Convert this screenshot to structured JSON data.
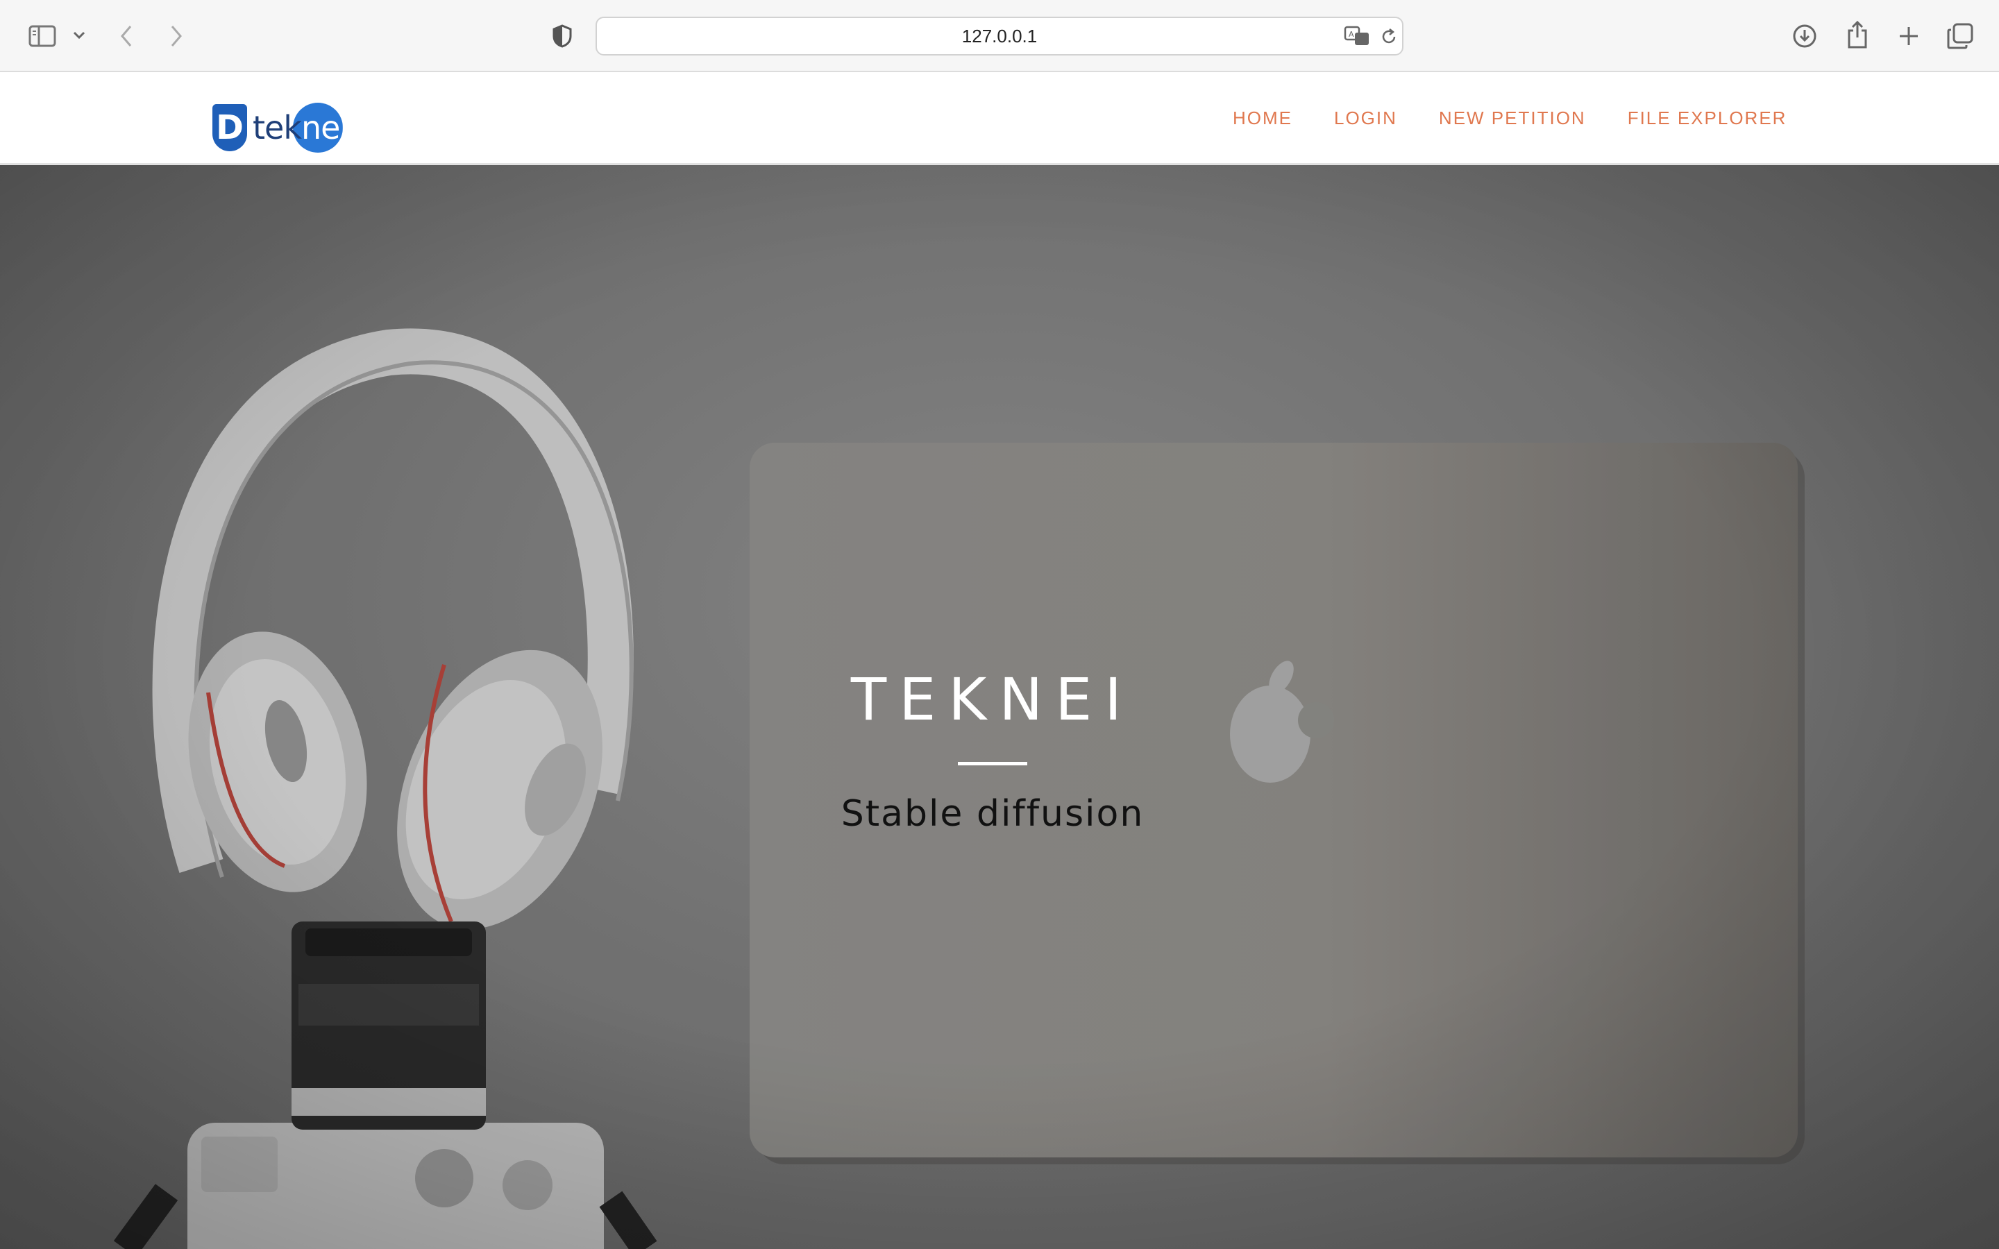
{
  "browser": {
    "url": "127.0.0.1",
    "icons": [
      "sidebar-icon",
      "chevron-down-icon",
      "back-icon",
      "forward-icon",
      "shield-icon",
      "translate-icon",
      "reload-icon",
      "download-icon",
      "share-icon",
      "new-tab-icon",
      "tabs-overview-icon"
    ]
  },
  "site": {
    "logo": {
      "letter": "D",
      "text_part1": "tek",
      "text_part2": "nei"
    },
    "nav": [
      "HOME",
      "LOGIN",
      "NEW PETITION",
      "FILE EXPLORER"
    ],
    "accent_color": "#e0784f"
  },
  "hero": {
    "title": "TEKNEI",
    "subtitle": "Stable diffusion"
  }
}
